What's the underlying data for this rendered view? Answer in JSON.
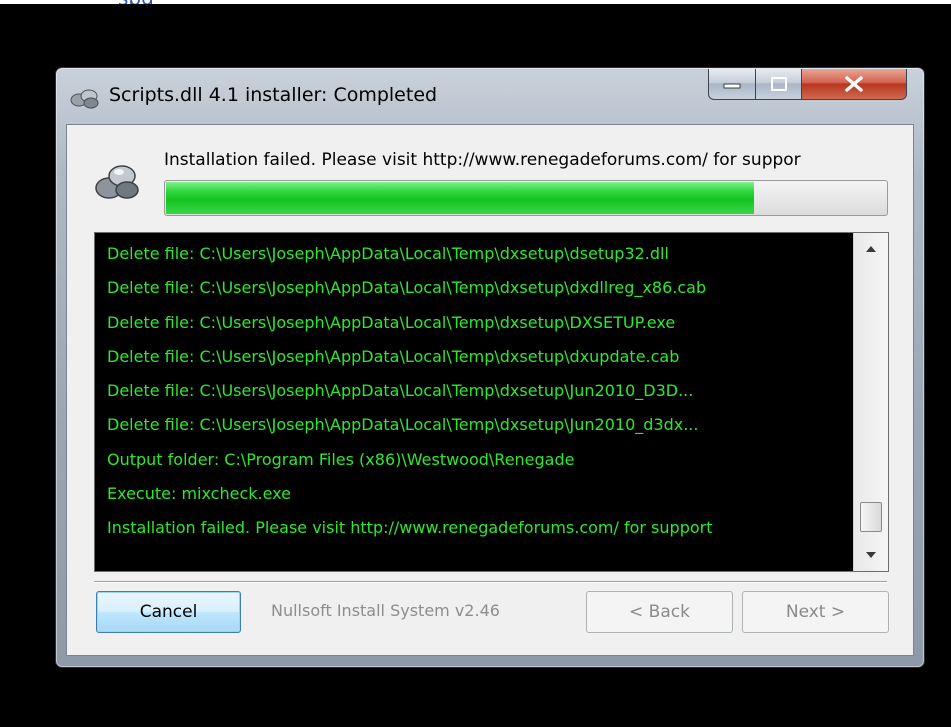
{
  "top_link": "spg",
  "window": {
    "title": "Scripts.dll 4.1 installer: Completed"
  },
  "status_text": "Installation failed. Please visit http://www.renegadeforums.com/ for suppor",
  "progress": 0.815,
  "log": {
    "lines": [
      "Delete file: C:\\Users\\Joseph\\AppData\\Local\\Temp\\dxsetup\\dsetup32.dll",
      "Delete file: C:\\Users\\Joseph\\AppData\\Local\\Temp\\dxsetup\\dxdllreg_x86.cab",
      "Delete file: C:\\Users\\Joseph\\AppData\\Local\\Temp\\dxsetup\\DXSETUP.exe",
      "Delete file: C:\\Users\\Joseph\\AppData\\Local\\Temp\\dxsetup\\dxupdate.cab",
      "Delete file: C:\\Users\\Joseph\\AppData\\Local\\Temp\\dxsetup\\Jun2010_D3D...",
      "Delete file: C:\\Users\\Joseph\\AppData\\Local\\Temp\\dxsetup\\Jun2010_d3dx...",
      "Output folder: C:\\Program Files (x86)\\Westwood\\Renegade",
      "Execute: mixcheck.exe",
      "Installation failed. Please visit http://www.renegadeforums.com/ for support"
    ]
  },
  "buttons": {
    "cancel": "Cancel",
    "back": "< Back",
    "next": "Next >"
  },
  "branding": "Nullsoft Install System v2.46",
  "colors": {
    "log_text": "#2ee82e",
    "progress": "#14c41f",
    "close": "#c94a32"
  }
}
